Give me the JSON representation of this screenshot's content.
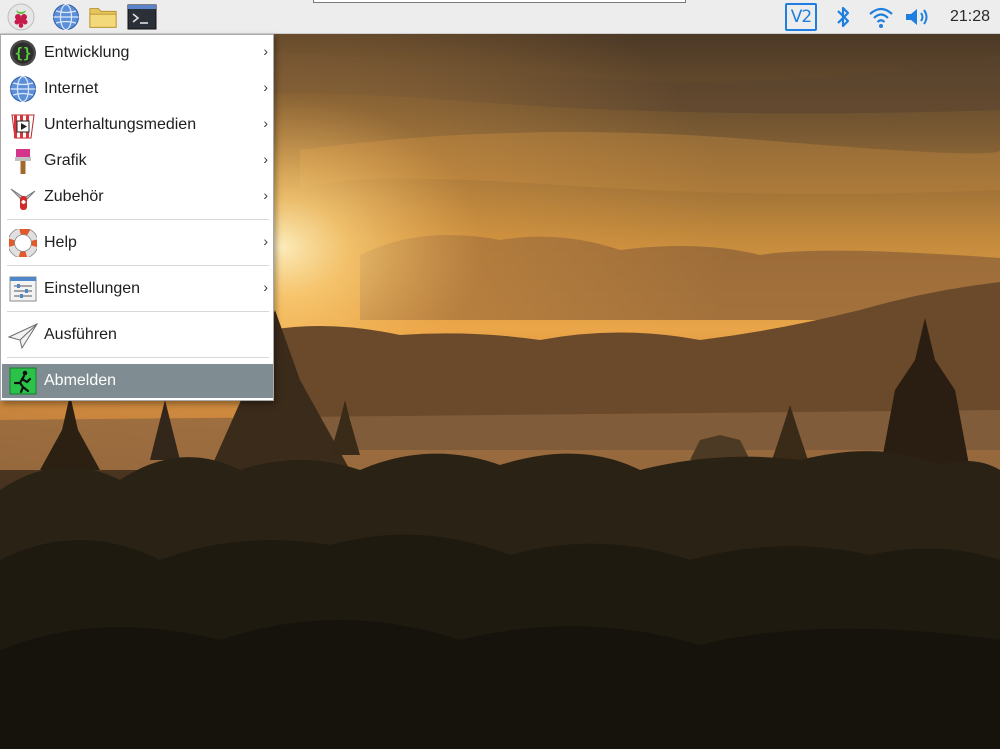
{
  "panel": {
    "launchers": [
      {
        "name": "raspberry-menu-icon"
      },
      {
        "name": "web-browser-icon"
      },
      {
        "name": "file-manager-icon"
      },
      {
        "name": "terminal-icon"
      }
    ],
    "tray": {
      "vnc_label": "V2",
      "bluetooth_icon": "bluetooth-icon",
      "wifi_icon": "wifi-icon",
      "volume_icon": "volume-icon",
      "clock": "21:28"
    }
  },
  "menu": {
    "items": [
      {
        "label": "Entwicklung",
        "icon": "programming-icon",
        "submenu": "›"
      },
      {
        "label": "Internet",
        "icon": "internet-globe-icon",
        "submenu": "›"
      },
      {
        "label": "Unterhaltungsmedien",
        "icon": "multimedia-popcorn-icon",
        "submenu": "›"
      },
      {
        "label": "Grafik",
        "icon": "graphics-brush-icon",
        "submenu": "›"
      },
      {
        "label": "Zubehör",
        "icon": "accessories-knife-icon",
        "submenu": "›"
      },
      {
        "label": "Help",
        "icon": "help-lifebuoy-icon",
        "submenu": "›"
      },
      {
        "label": "Einstellungen",
        "icon": "preferences-icon",
        "submenu": "›"
      },
      {
        "label": "Ausführen",
        "icon": "run-paperplane-icon",
        "submenu": ""
      },
      {
        "label": "Abmelden",
        "icon": "logout-runner-icon",
        "submenu": "",
        "active": true
      }
    ]
  },
  "colors": {
    "panel_bg": "#ededed",
    "menu_highlight": "#7f8c91",
    "tray_accent": "#1f7fe0"
  }
}
